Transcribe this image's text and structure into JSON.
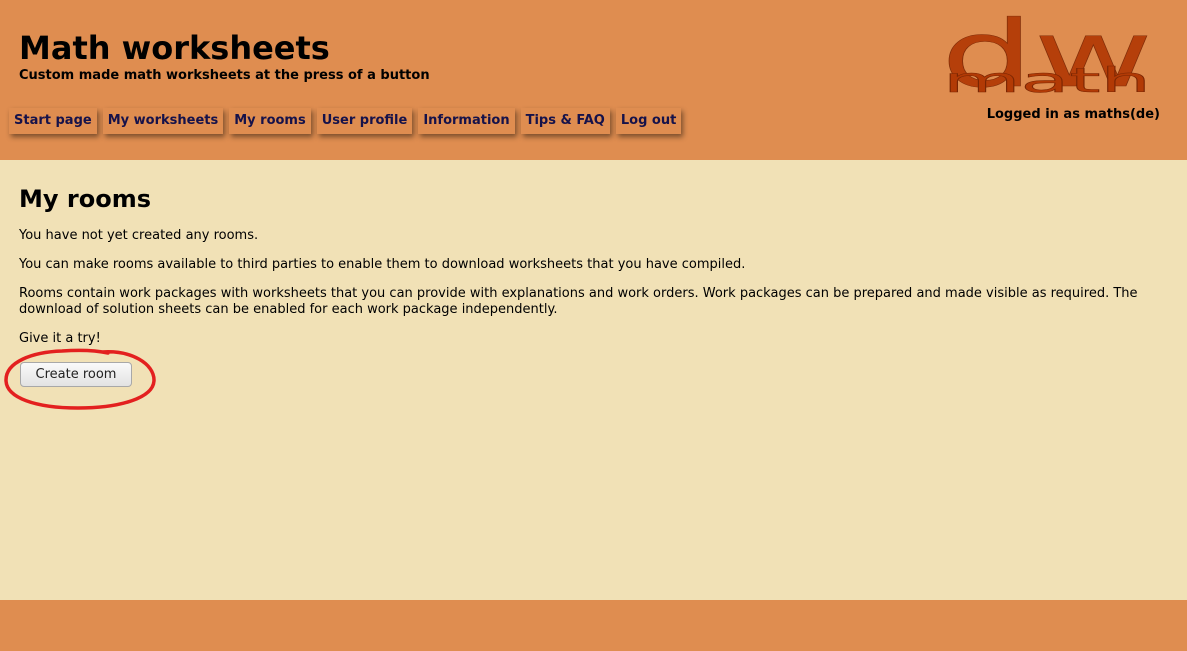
{
  "header": {
    "title": "Math worksheets",
    "subtitle": "Custom made math worksheets at the press of a button",
    "logged_in": "Logged in as maths(de)",
    "logo": {
      "top_text": "dw",
      "bottom_text": "math",
      "color": "#b23a05"
    }
  },
  "nav": {
    "items": [
      {
        "label": "Start page"
      },
      {
        "label": "My worksheets"
      },
      {
        "label": "My rooms"
      },
      {
        "label": "User profile"
      },
      {
        "label": "Information"
      },
      {
        "label": "Tips & FAQ"
      },
      {
        "label": "Log out"
      }
    ]
  },
  "main": {
    "title": "My rooms",
    "paragraphs": [
      "You have not yet created any rooms.",
      "You can make rooms available to third parties to enable them to download worksheets that you have compiled.",
      "Rooms contain work packages with worksheets that you can provide with explanations and work orders. Work packages can be prepared and made visible as required. The download of solution sheets can be enabled for each work package independently.",
      "Give it a try!"
    ],
    "create_button": "Create room"
  },
  "colors": {
    "header_bg": "#df8d50",
    "content_bg": "#f1e1b6",
    "nav_text": "#16124a",
    "highlight_circle": "#e3201f"
  }
}
